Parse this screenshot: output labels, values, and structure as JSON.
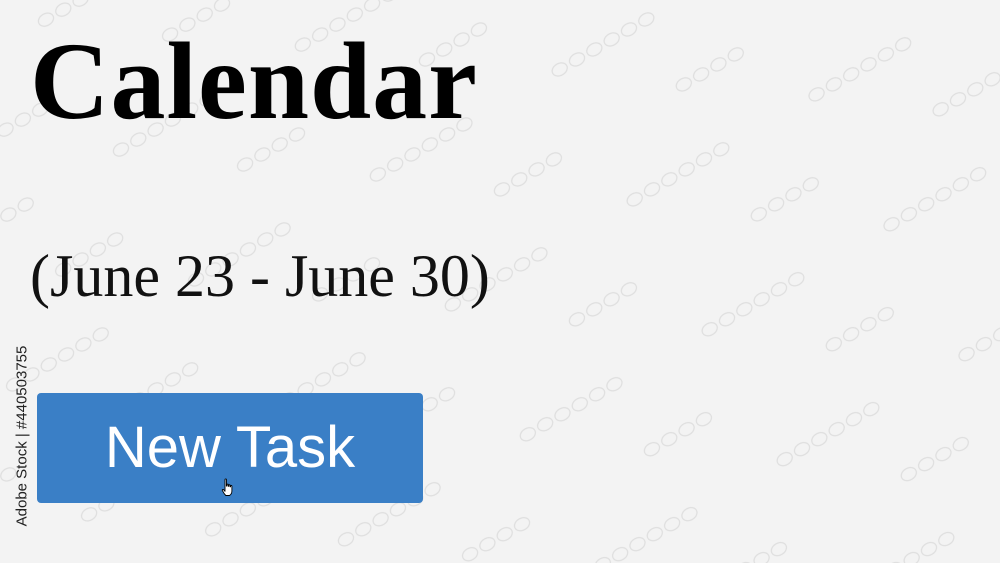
{
  "page": {
    "title": "Calendar",
    "date_range": "(June 23 - June 30)"
  },
  "actions": {
    "new_task_label": "New Task"
  },
  "watermark": {
    "text": "Adobe Stock | #440503755"
  },
  "colors": {
    "background": "#f3f3f3",
    "button": "#3a7fc6",
    "button_text": "#ffffff",
    "text": "#000000"
  },
  "icons": {
    "cursor": "hand-pointer-icon"
  }
}
